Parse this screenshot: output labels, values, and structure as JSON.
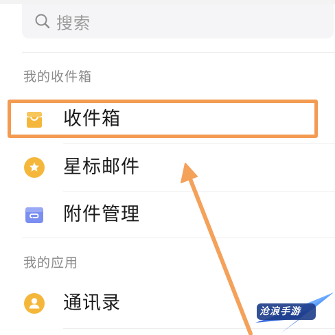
{
  "search": {
    "placeholder": "搜索"
  },
  "sections": {
    "mailbox": {
      "title": "我的收件箱",
      "items": [
        {
          "label": "收件箱",
          "icon": "inbox-icon",
          "color": "#f5b73b"
        },
        {
          "label": "星标邮件",
          "icon": "star-icon",
          "color": "#f5b73b"
        },
        {
          "label": "附件管理",
          "icon": "attachment-folder-icon",
          "color": "#7b8ff0"
        }
      ]
    },
    "apps": {
      "title": "我的应用",
      "items": [
        {
          "label": "通讯录",
          "icon": "contacts-icon",
          "color": "#f5b73b"
        }
      ]
    }
  },
  "watermark": {
    "text": "沧浪手游"
  },
  "colors": {
    "highlight": "#f39b52",
    "arrow": "#f4a15a",
    "section_text": "#8a8a8a"
  }
}
